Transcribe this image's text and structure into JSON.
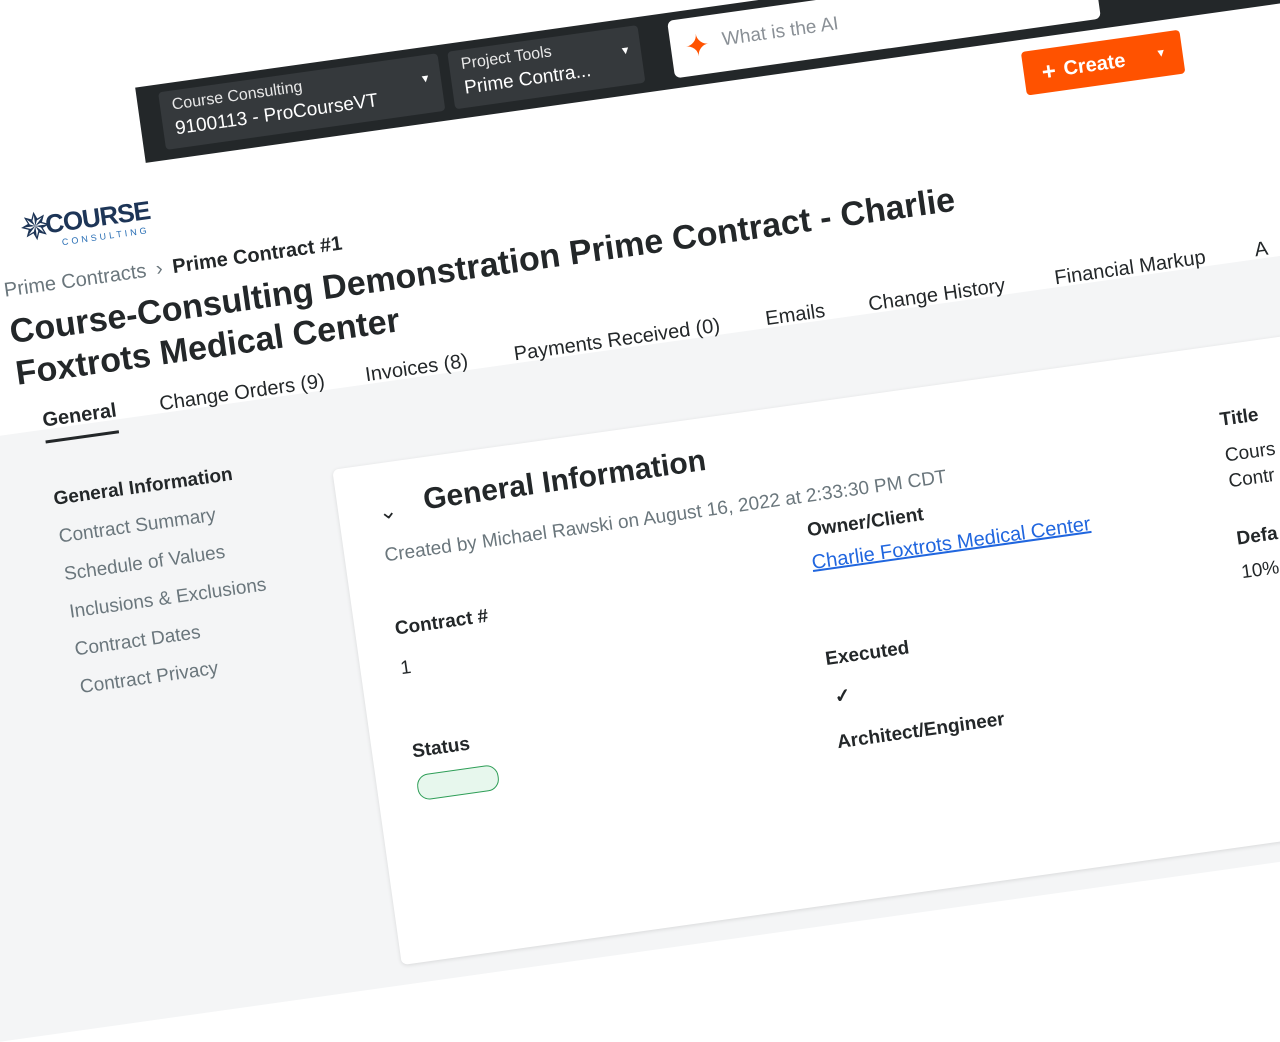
{
  "header": {
    "company_selector": {
      "label": "Course Consulting",
      "value": "9100113 - ProCourseVT"
    },
    "tools_selector": {
      "label": "Project Tools",
      "value": "Prime Contra..."
    },
    "search": {
      "placeholder": "What is the AI"
    },
    "create_label": "Create"
  },
  "logo": {
    "main": "COURSE",
    "sub": "CONSULTING"
  },
  "breadcrumb": {
    "previous": "Prime Contracts",
    "current": "Prime Contract #1"
  },
  "page_title": "Course-Consulting Demonstration Prime Contract - Charlie Foxtrots Medical Center",
  "tabs": [
    "General",
    "Change Orders (9)",
    "Invoices (8)",
    "Payments Received (0)",
    "Emails",
    "Change History",
    "Financial Markup",
    "A"
  ],
  "sidebar": {
    "items": [
      "General Information",
      "Contract Summary",
      "Schedule of Values",
      "Inclusions & Exclusions",
      "Contract Dates",
      "Contract Privacy"
    ]
  },
  "general_info": {
    "title": "General Information",
    "created_by": "Created by Michael Rawski on August 16, 2022 at 2:33:30 PM CDT",
    "contract_no_label": "Contract #",
    "contract_no_value": "1",
    "status_label": "Status",
    "owner_label": "Owner/Client",
    "owner_value": "Charlie Foxtrots Medical Center",
    "executed_label": "Executed",
    "executed_value": "✓",
    "architect_label": "Architect/Engineer",
    "title_label": "Title",
    "title_value_1": "Cours",
    "title_value_2": "Contr",
    "default_label": "Defa",
    "default_value": "10%"
  },
  "colors": {
    "accent": "#ff5200",
    "topbar": "#232729",
    "link": "#2066df"
  },
  "icons": [
    "search-ai-icon",
    "plus-icon",
    "chevron-down-icon",
    "collapse-chevron-icon",
    "checkmark-icon",
    "compass-logo-icon"
  ]
}
